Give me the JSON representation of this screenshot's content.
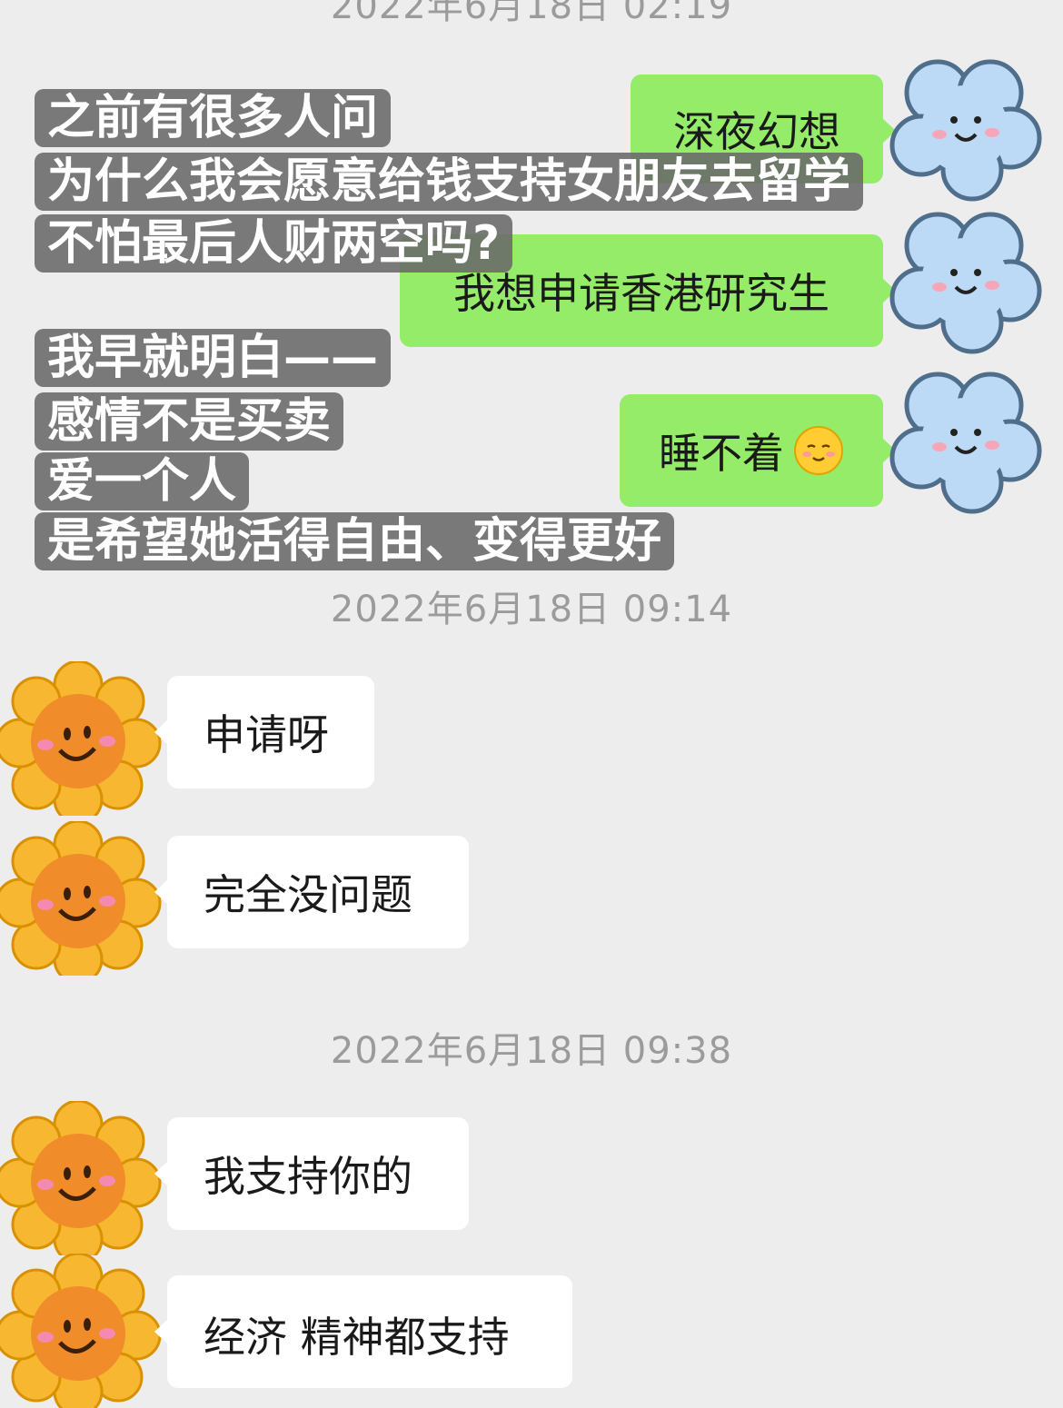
{
  "timestamps": [
    "2022年6月18日 02:19",
    "2022年6月18日 09:14",
    "2022年6月18日 09:38"
  ],
  "sent": [
    {
      "text": "深夜幻想"
    },
    {
      "text": "我想申请香港研究生"
    },
    {
      "text": "睡不着",
      "emoji": "shy-smile-emoji"
    }
  ],
  "received": [
    {
      "text": "申请呀"
    },
    {
      "text": "完全没问题"
    },
    {
      "text": "我支持你的"
    },
    {
      "text": "经济 精神都支持"
    }
  ],
  "caption_top": [
    "之前有很多人问",
    "为什么我会愿意给钱支持女朋友去留学",
    "不怕最后人财两空吗?"
  ],
  "caption_bottom": [
    "我早就明白——",
    "感情不是买卖",
    "爱一个人",
    "是希望她活得自由、变得更好"
  ],
  "avatars": {
    "self": "cloud-avatar-icon",
    "other": "sunflower-avatar-icon"
  },
  "colors": {
    "background": "#ededed",
    "sent_bubble": "#95ec69",
    "received_bubble": "#ffffff",
    "timestamp": "#9b9b9b",
    "caption_bg": "#696969"
  }
}
